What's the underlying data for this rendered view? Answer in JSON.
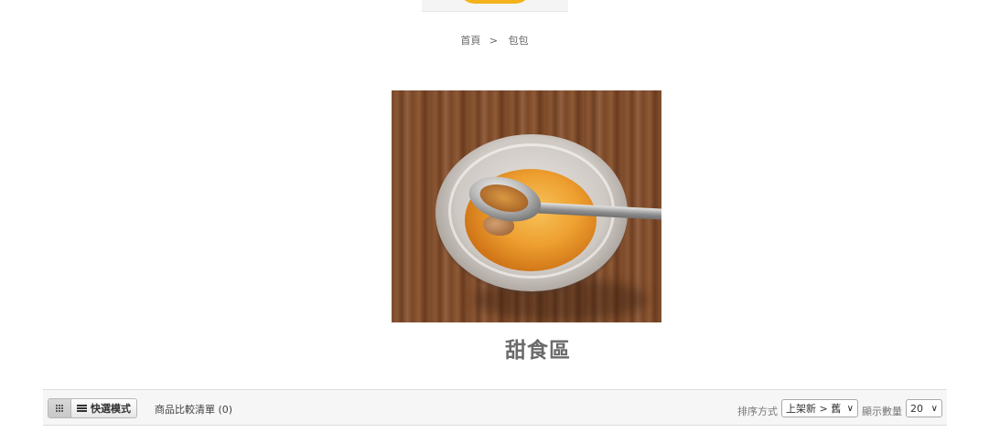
{
  "header": {
    "logo_icon": "pudding-logo-icon"
  },
  "breadcrumb": {
    "home": "首頁",
    "separator": ">",
    "current": "包包"
  },
  "category": {
    "image_icon": "pudding-photo",
    "title": "甜食區"
  },
  "toolbar": {
    "grid_icon": "grid-icon",
    "list_icon": "list-icon",
    "list_label": "快選模式",
    "compare_label": "商品比較清單 (0)",
    "sort_label": "排序方式",
    "sort_value": "上架新 > 舊",
    "limit_label": "顯示數量",
    "limit_value": "20"
  }
}
